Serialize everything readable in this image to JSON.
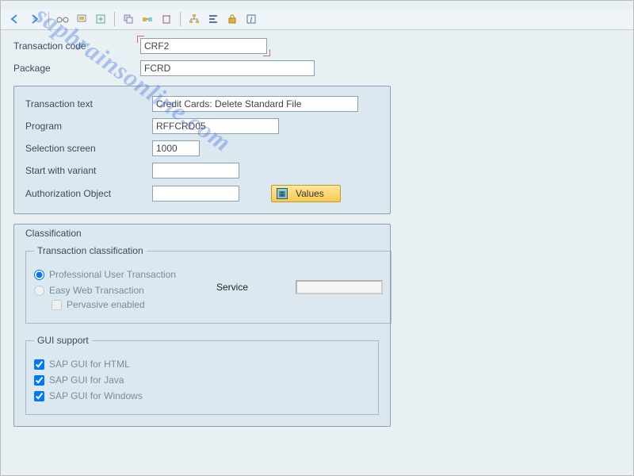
{
  "toolbar": {
    "icons": [
      "back",
      "forward",
      "glasses",
      "display",
      "create",
      "copy",
      "delete",
      "hierarchy",
      "align",
      "lock",
      "info"
    ]
  },
  "fields": {
    "tcode_label": "Transaction code",
    "tcode_value": "CRF2",
    "package_label": "Package",
    "package_value": "FCRD"
  },
  "details": {
    "ttext_label": "Transaction text",
    "ttext_value": "Credit Cards: Delete Standard File",
    "program_label": "Program",
    "program_value": "RFFCRD05",
    "selscreen_label": "Selection screen",
    "selscreen_value": "1000",
    "variant_label": "Start with variant",
    "variant_value": "",
    "authobj_label": "Authorization Object",
    "authobj_value": "",
    "values_btn": "Values"
  },
  "classification": {
    "group_label": "Classification",
    "tc_label": "Transaction classification",
    "radio_prof": "Professional User Transaction",
    "radio_easy": "Easy Web Transaction",
    "service_label": "Service",
    "service_value": "",
    "pervasive_label": "Pervasive enabled",
    "gui_label": "GUI support",
    "gui_html": "SAP GUI for HTML",
    "gui_java": "SAP GUI for Java",
    "gui_win": "SAP GUI for Windows"
  },
  "watermark": "sapbrainsonline.com"
}
